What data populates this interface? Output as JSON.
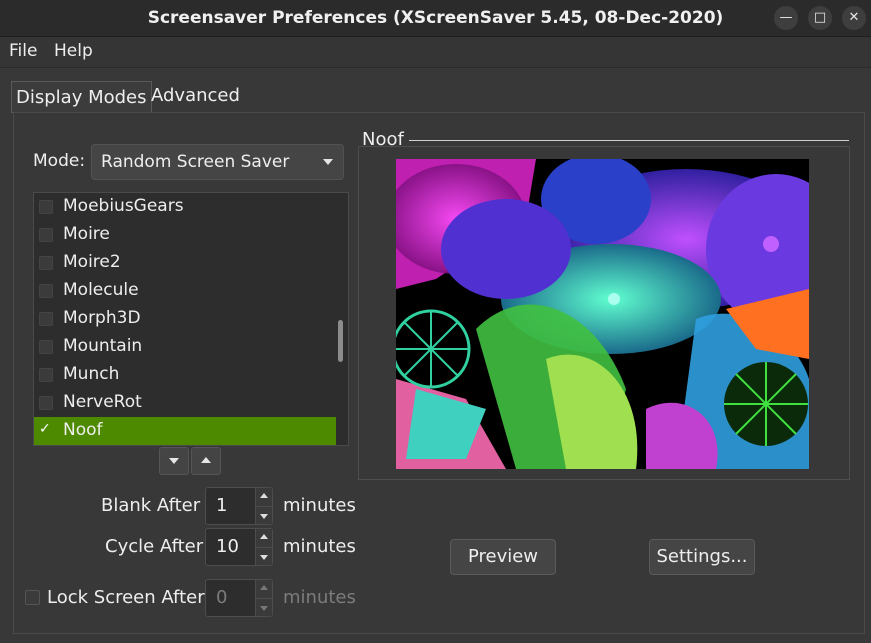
{
  "window": {
    "title": "Screensaver Preferences  (XScreenSaver 5.45, 08-Dec-2020)",
    "minimize_icon": "minimize-icon",
    "maximize_icon": "maximize-icon",
    "close_icon": "close-icon"
  },
  "menu": {
    "file": "File",
    "help": "Help"
  },
  "tabs": [
    {
      "label": "Display Modes",
      "active": true
    },
    {
      "label": "Advanced",
      "active": false
    }
  ],
  "mode": {
    "label": "Mode:",
    "selected": "Random Screen Saver"
  },
  "savers": [
    {
      "name": "MoebiusGears",
      "checked": false
    },
    {
      "name": "Moire",
      "checked": false
    },
    {
      "name": "Moire2",
      "checked": false
    },
    {
      "name": "Molecule",
      "checked": false
    },
    {
      "name": "Morph3D",
      "checked": false
    },
    {
      "name": "Mountain",
      "checked": false
    },
    {
      "name": "Munch",
      "checked": false
    },
    {
      "name": "NerveRot",
      "checked": false
    },
    {
      "name": "Noof",
      "checked": true,
      "selected": true
    }
  ],
  "timing": {
    "blank_label": "Blank After",
    "blank_value": "1",
    "blank_unit": "minutes",
    "cycle_label": "Cycle After",
    "cycle_value": "10",
    "cycle_unit": "minutes",
    "lock_label": "Lock Screen After",
    "lock_value": "0",
    "lock_unit": "minutes",
    "lock_checked": false
  },
  "preview": {
    "title": "Noof",
    "preview_button": "Preview",
    "settings_button": "Settings..."
  },
  "colors": {
    "selection": "#4e8a00",
    "background": "#383838"
  }
}
